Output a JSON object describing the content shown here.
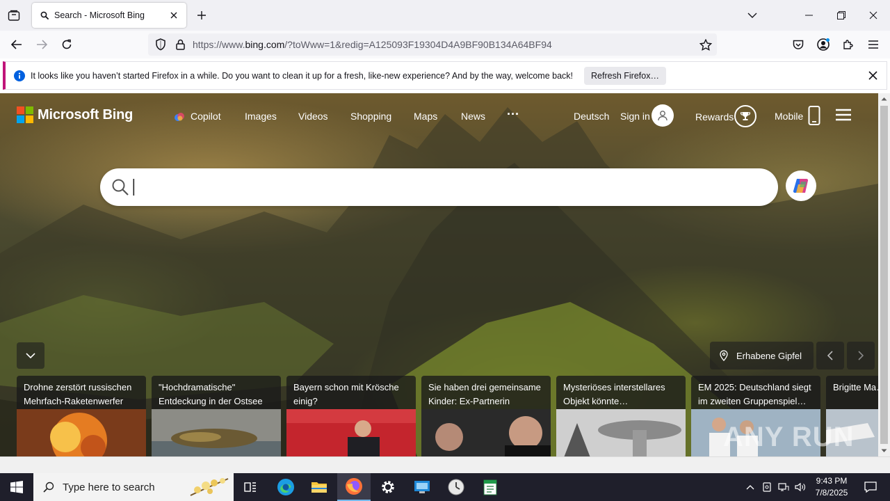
{
  "browser": {
    "tab": {
      "title": "Search - Microsoft Bing"
    },
    "url": {
      "prefix": "https://www.",
      "domain": "bing.com",
      "rest": "/?toWww=1&redig=A125093F19304D4A9BF90B134A64BF94"
    },
    "notification": {
      "message": "It looks like you haven’t started Firefox in a while. Do you want to clean it up for a fresh, like-new experience? And by the way, welcome back!",
      "button": "Refresh Firefox…"
    }
  },
  "bing": {
    "brand": "Microsoft Bing",
    "nav": {
      "copilot": "Copilot",
      "images": "Images",
      "videos": "Videos",
      "shopping": "Shopping",
      "maps": "Maps",
      "news": "News",
      "more": "···",
      "language": "Deutsch",
      "signin": "Sign in",
      "rewards": "Rewards",
      "mobile": "Mobile"
    },
    "search": {
      "value": ""
    },
    "location": "Erhabene Gipfel",
    "news": [
      {
        "title": "Drohne zerstört russischen Mehrfach-Raketenwerfer –…"
      },
      {
        "title": "\"Hochdramatische\" Entdeckung in der Ostsee"
      },
      {
        "title": "Bayern schon mit Krösche einig?"
      },
      {
        "title": "Sie haben drei gemeinsame Kinder: Ex-Partnerin Grimes…"
      },
      {
        "title": "Mysteriöses interstellares Objekt könnte…"
      },
      {
        "title": "EM 2025: Deutschland siegt im zweiten Gruppenspiel…"
      },
      {
        "title": "Brigitte Ma… Lady ignori…"
      }
    ],
    "watermark": "ANY RUN"
  },
  "taskbar": {
    "search_placeholder": "Type here to search",
    "time": "9:43 PM",
    "date": "7/8/2025"
  },
  "colors": {
    "accent_firefox": "#c0147a",
    "ms_red": "#f25022",
    "ms_green": "#7fba00",
    "ms_blue": "#00a4ef",
    "ms_yellow": "#ffb900"
  }
}
